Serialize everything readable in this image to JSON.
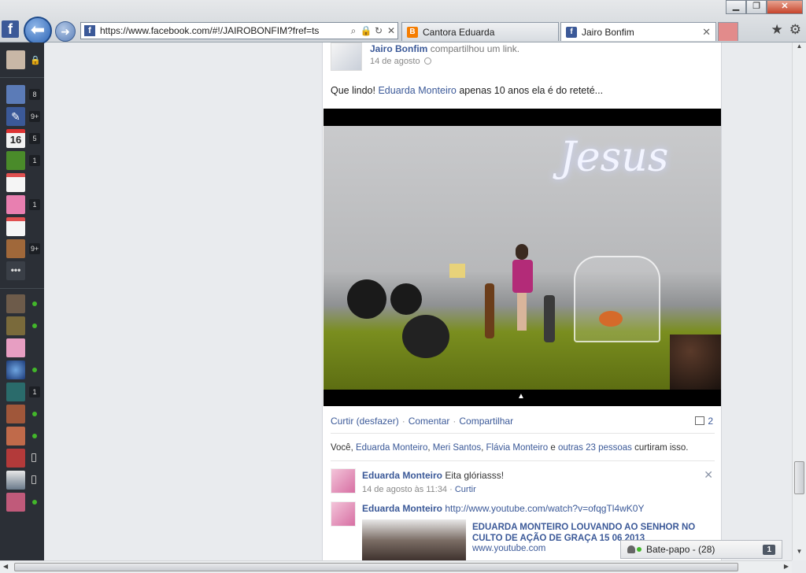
{
  "window_controls": {
    "minimize": "▁",
    "maximize": "❐",
    "close": "✕"
  },
  "browser": {
    "back_glyph": "⬅",
    "forward_glyph": "➜",
    "url": "https://www.facebook.com/#!/JAIROBONFIM?fref=ts",
    "tabs": [
      {
        "label": "Cantora Eduarda",
        "icon": "blogger-icon",
        "color": "#f57d00"
      },
      {
        "label": "Jairo Bonfim",
        "icon": "facebook-icon",
        "color": "#3b5998",
        "close": "✕"
      }
    ],
    "toolbar_icons": {
      "favorites": "★",
      "settings": "⚙"
    }
  },
  "sidebar": {
    "lock_glyph": "🔒",
    "apps": [
      {
        "name": "profile",
        "badge": "",
        "color": "#c8b7a6"
      },
      {
        "name": "pages",
        "badge": "8",
        "color": "#5b7bb7"
      },
      {
        "name": "messages",
        "badge": "9+",
        "color": "#3b5998"
      },
      {
        "name": "events",
        "badge": "5",
        "color": "#e8e8e8",
        "text": "16"
      },
      {
        "name": "farm-game",
        "badge": "1",
        "color": "#4a8b2a"
      },
      {
        "name": "calendar-app",
        "badge": "",
        "color": "#e05050"
      },
      {
        "name": "photo-app",
        "badge": "1",
        "color": "#e87fb0"
      },
      {
        "name": "calendar-app-2",
        "badge": "",
        "color": "#e05050"
      },
      {
        "name": "notes-app",
        "badge": "9+",
        "color": "#a0683a"
      },
      {
        "name": "more",
        "badge": "",
        "color": "#3a3f47",
        "text": "•••"
      }
    ],
    "friends": [
      {
        "status": "online",
        "color": "#6d5b4a"
      },
      {
        "status": "online",
        "color": "#7a6a3b"
      },
      {
        "status": "none",
        "color": "#e79ec2"
      },
      {
        "status": "online",
        "color": "#2c4a8a"
      },
      {
        "status": "badge",
        "badge": "1",
        "color": "#2a6b6b"
      },
      {
        "status": "online",
        "color": "#a0573a"
      },
      {
        "status": "online",
        "color": "#c06a4a"
      },
      {
        "status": "mobile",
        "color": "#b33a3a"
      },
      {
        "status": "mobile",
        "color": "#6a7a8a"
      },
      {
        "status": "online",
        "color": "#c05a7a"
      }
    ]
  },
  "post": {
    "author": "Jairo Bonfim",
    "action": "compartilhou um link.",
    "date": "14 de agosto",
    "text_before": "Que lindo! ",
    "text_link": "Eduarda Monteiro",
    "text_after": " apenas 10 anos ela é do reteté...",
    "video": {
      "sign_text": "Jesus",
      "expand_glyph": "▲"
    },
    "actions": [
      "Curtir (desfazer)",
      "Comentar",
      "Compartilhar"
    ],
    "action_sep": "·",
    "comment_count": "2",
    "likes": {
      "prefix": "Você, ",
      "names": [
        "Eduarda Monteiro",
        "Meri Santos",
        "Flávia Monteiro"
      ],
      "sep": ", ",
      "and_word": " e ",
      "others": "outras 23 pessoas",
      "suffix": " curtiram isso."
    },
    "comments": [
      {
        "author": "Eduarda Monteiro",
        "text": " Eita glóriasss!",
        "meta": "14 de agosto às 11:34",
        "meta_sep": " · ",
        "meta_action": "Curtir",
        "close": "✕"
      },
      {
        "author": "Eduarda Monteiro",
        "text": " http://www.youtube.com/watch?v=ofqgTl4wK0Y",
        "link_title": "EDUARDA MONTEIRO LOUVANDO AO SENHOR NO CULTO DE AÇÃO DE GRAÇA 15 06 2013",
        "link_domain": "www.youtube.com"
      }
    ]
  },
  "chat": {
    "label": "Bate-papo - (28)",
    "count": "1"
  },
  "scrollbars": {
    "up": "▲",
    "down": "▼",
    "left": "◀",
    "right": "▶"
  }
}
